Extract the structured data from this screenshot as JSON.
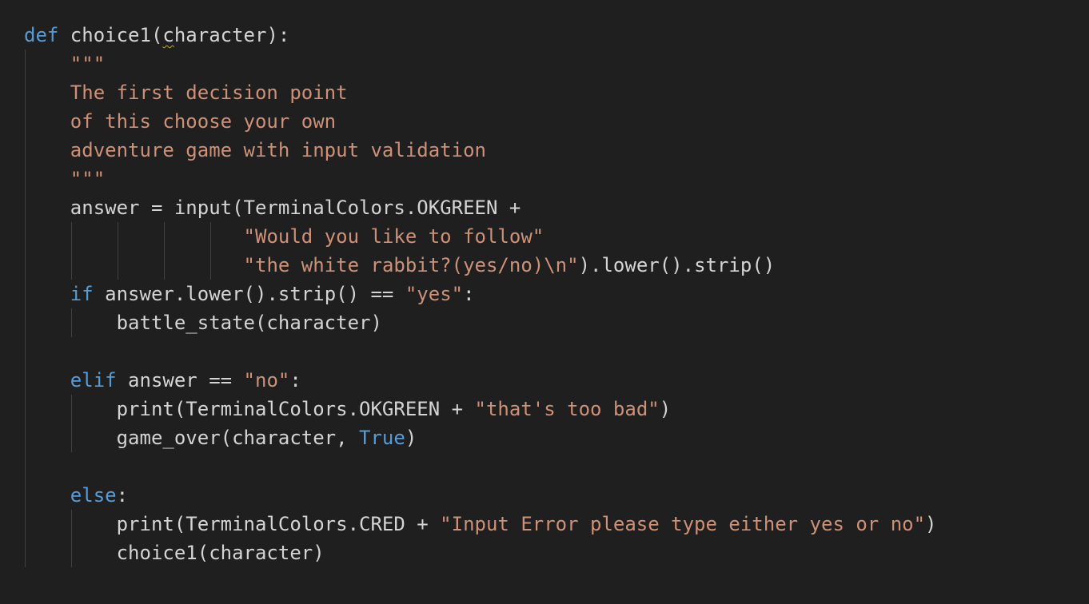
{
  "code": {
    "language": "python",
    "keyword_color": "#569cd6",
    "string_color": "#ce9178",
    "text_color": "#d4d4d4",
    "background": "#1f1f1f",
    "lines": [
      {
        "id": "l1",
        "tokens": [
          {
            "t": "def",
            "c": "kw"
          },
          {
            "t": " choice1(",
            "c": "fn"
          },
          {
            "t": "c",
            "c": "squiggle"
          },
          {
            "t": "haracter):",
            "c": "fn"
          }
        ]
      },
      {
        "id": "l2",
        "tokens": [
          {
            "t": "    \"\"\"",
            "c": "str"
          }
        ]
      },
      {
        "id": "l3",
        "tokens": [
          {
            "t": "    The first decision point",
            "c": "str"
          }
        ]
      },
      {
        "id": "l4",
        "tokens": [
          {
            "t": "    of this choose your own",
            "c": "str"
          }
        ]
      },
      {
        "id": "l5",
        "tokens": [
          {
            "t": "    adventure game with input validation",
            "c": "str"
          }
        ]
      },
      {
        "id": "l6",
        "tokens": [
          {
            "t": "    \"\"\"",
            "c": "str"
          }
        ]
      },
      {
        "id": "l7",
        "tokens": [
          {
            "t": "    answer = input(TerminalColors.OKGREEN +",
            "c": "fn"
          }
        ]
      },
      {
        "id": "l8",
        "tokens": [
          {
            "t": "                   ",
            "c": "fn"
          },
          {
            "t": "\"Would you like to follow\"",
            "c": "str"
          }
        ]
      },
      {
        "id": "l9",
        "tokens": [
          {
            "t": "                   ",
            "c": "fn"
          },
          {
            "t": "\"the white rabbit?(yes/no)\\n\"",
            "c": "str"
          },
          {
            "t": ").lower().strip()",
            "c": "fn"
          }
        ]
      },
      {
        "id": "l10",
        "tokens": [
          {
            "t": "    ",
            "c": "fn"
          },
          {
            "t": "if",
            "c": "kw"
          },
          {
            "t": " answer.lower().strip() == ",
            "c": "fn"
          },
          {
            "t": "\"yes\"",
            "c": "str"
          },
          {
            "t": ":",
            "c": "fn"
          }
        ]
      },
      {
        "id": "l11",
        "tokens": [
          {
            "t": "        battle_state(character)",
            "c": "fn"
          }
        ]
      },
      {
        "id": "l12",
        "tokens": []
      },
      {
        "id": "l13",
        "tokens": [
          {
            "t": "    ",
            "c": "fn"
          },
          {
            "t": "elif",
            "c": "kw"
          },
          {
            "t": " answer == ",
            "c": "fn"
          },
          {
            "t": "\"no\"",
            "c": "str"
          },
          {
            "t": ":",
            "c": "fn"
          }
        ]
      },
      {
        "id": "l14",
        "tokens": [
          {
            "t": "        print(TerminalColors.OKGREEN + ",
            "c": "fn"
          },
          {
            "t": "\"that's too bad\"",
            "c": "str"
          },
          {
            "t": ")",
            "c": "fn"
          }
        ]
      },
      {
        "id": "l15",
        "tokens": [
          {
            "t": "        game_over(character, ",
            "c": "fn"
          },
          {
            "t": "True",
            "c": "kw"
          },
          {
            "t": ")",
            "c": "fn"
          }
        ]
      },
      {
        "id": "l16",
        "tokens": []
      },
      {
        "id": "l17",
        "tokens": [
          {
            "t": "    ",
            "c": "fn"
          },
          {
            "t": "else",
            "c": "kw"
          },
          {
            "t": ":",
            "c": "fn"
          }
        ]
      },
      {
        "id": "l18",
        "tokens": [
          {
            "t": "        print(TerminalColors.CRED + ",
            "c": "fn"
          },
          {
            "t": "\"Input Error please type either yes or no\"",
            "c": "str"
          },
          {
            "t": ")",
            "c": "fn"
          }
        ]
      },
      {
        "id": "l19",
        "tokens": [
          {
            "t": "        choice1(character)",
            "c": "fn"
          }
        ]
      }
    ]
  }
}
